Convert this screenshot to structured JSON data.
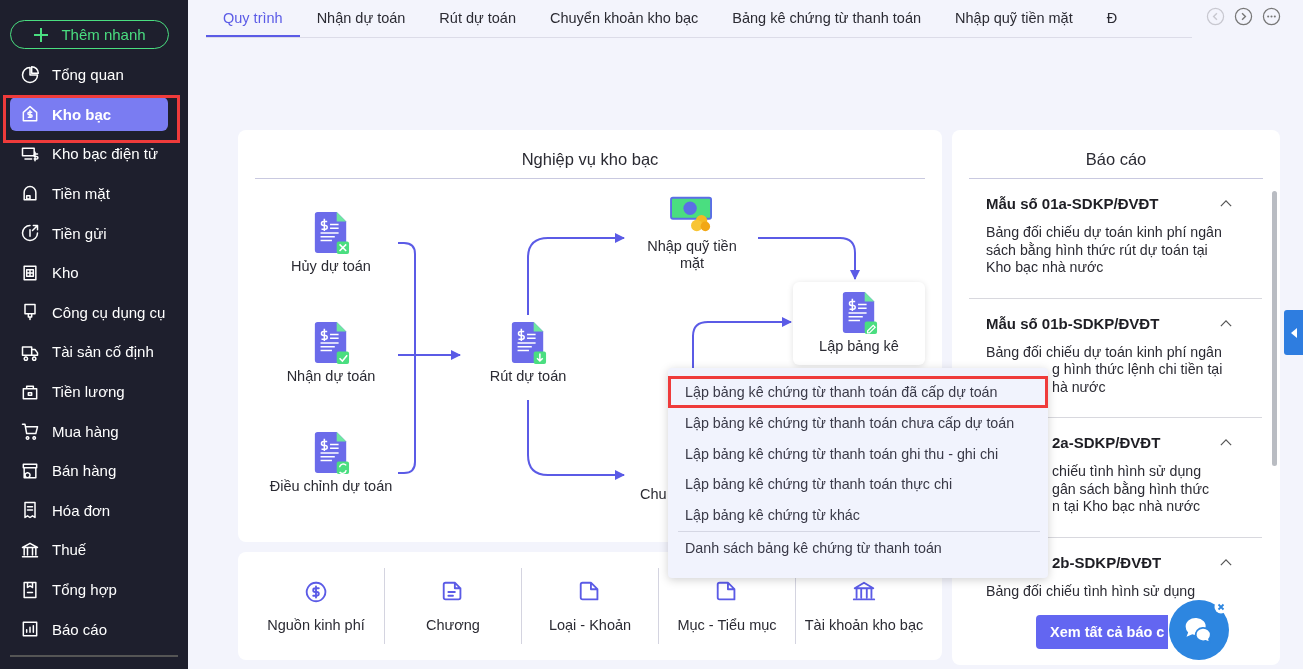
{
  "sidebar": {
    "quick_add_button": "Thêm nhanh",
    "items": [
      {
        "label": "Tổng quan",
        "selected": false,
        "highlighted": false
      },
      {
        "label": "Kho bạc",
        "selected": true,
        "highlighted": true
      },
      {
        "label": "Kho bạc điện tử",
        "selected": false,
        "highlighted": false
      },
      {
        "label": "Tiền mặt",
        "selected": false,
        "highlighted": false
      },
      {
        "label": "Tiền gửi",
        "selected": false,
        "highlighted": false
      },
      {
        "label": "Kho",
        "selected": false,
        "highlighted": false
      },
      {
        "label": "Công cụ dụng cụ",
        "selected": false,
        "highlighted": false
      },
      {
        "label": "Tài sản cố định",
        "selected": false,
        "highlighted": false
      },
      {
        "label": "Tiền lương",
        "selected": false,
        "highlighted": false
      },
      {
        "label": "Mua hàng",
        "selected": false,
        "highlighted": false
      },
      {
        "label": "Bán hàng",
        "selected": false,
        "highlighted": false
      },
      {
        "label": "Hóa đơn",
        "selected": false,
        "highlighted": false
      },
      {
        "label": "Thuế",
        "selected": false,
        "highlighted": false
      },
      {
        "label": "Tổng hợp",
        "selected": false,
        "highlighted": false
      },
      {
        "label": "Báo cáo",
        "selected": false,
        "highlighted": false
      }
    ]
  },
  "tabs": [
    {
      "label": "Quy trình",
      "selected": true
    },
    {
      "label": "Nhận dự toán",
      "selected": false
    },
    {
      "label": "Rút dự toán",
      "selected": false
    },
    {
      "label": "Chuyển khoản kho bạc",
      "selected": false
    },
    {
      "label": "Bảng kê chứng từ thanh toán",
      "selected": false
    },
    {
      "label": "Nhập quỹ tiền mặt",
      "selected": false
    },
    {
      "label": "Đ",
      "selected": false
    }
  ],
  "workflow": {
    "title": "Nghiệp vụ kho bạc",
    "nodes": [
      {
        "label": "Hủy dự toán",
        "kind": "document"
      },
      {
        "label": "Nhận dự toán",
        "kind": "document"
      },
      {
        "label": "Điều chỉnh dự toán",
        "kind": "document"
      },
      {
        "label": "Rút dự toán",
        "kind": "document"
      },
      {
        "label": "Nhập quỹ tiền mặt",
        "kind": "cash"
      },
      {
        "label": "Lập bảng kê",
        "kind": "card"
      },
      {
        "label": "Chu",
        "kind": "text"
      }
    ]
  },
  "menu": {
    "items": [
      {
        "label": "Lập bảng kê chứng từ thanh toán đã cấp dự toán",
        "highlighted": true,
        "kind": "item"
      },
      {
        "label": "Lập bảng kê chứng từ thanh toán chưa cấp dự toán",
        "highlighted": false,
        "kind": "item"
      },
      {
        "label": "Lập bảng kê chứng từ thanh toán ghi thu - ghi chi",
        "highlighted": false,
        "kind": "item"
      },
      {
        "label": "Lập bảng kê chứng từ thanh toán thực chi",
        "highlighted": false,
        "kind": "item"
      },
      {
        "label": "Lập bảng kê chứng từ khác",
        "highlighted": false,
        "kind": "item"
      },
      {
        "label": "Danh sách bảng kê chứng từ thanh toán",
        "highlighted": false,
        "kind": "footer"
      }
    ]
  },
  "catalog": {
    "items": [
      {
        "label": "Nguồn kinh phí"
      },
      {
        "label": "Chương"
      },
      {
        "label": "Loại - Khoản"
      },
      {
        "label": "Mục - Tiểu mục"
      },
      {
        "label": "Tài khoản kho bạc"
      }
    ]
  },
  "reports": {
    "title": "Báo cáo",
    "items": [
      {
        "title": {
          "text": "Mẫu số 01a-SDKP/ĐVĐT",
          "cut": false
        },
        "lines": [
          {
            "text": "Bảng đối chiếu dự toán kinh phí ngân",
            "cut": false
          },
          {
            "text": "sách bằng hình thức rút dự toán tại",
            "cut": false
          },
          {
            "text": "Kho bạc nhà nước",
            "cut": false
          }
        ]
      },
      {
        "title": {
          "text": "Mẫu số 01b-SDKP/ĐVĐT",
          "cut": false
        },
        "lines": [
          {
            "text": "Bảng đối chiếu dự toán kinh phí ngân",
            "cut": false
          },
          {
            "text": "g hình thức lệnh chi tiền tại",
            "cut": true
          },
          {
            "text": "hà nước",
            "cut": true
          }
        ]
      },
      {
        "title": {
          "text": "2a-SDKP/ĐVĐT",
          "cut": true
        },
        "lines": [
          {
            "text": "chiếu tình hình sử dụng",
            "cut": true
          },
          {
            "text": "gân sách bằng hình thức",
            "cut": true
          },
          {
            "text": "n tại Kho bạc nhà nước",
            "cut": true
          }
        ]
      },
      {
        "title": {
          "text": "2b-SDKP/ĐVĐT",
          "cut": true
        },
        "lines": [
          {
            "text": "Bảng đối chiếu tình hình sử dụng",
            "cut": false
          }
        ]
      }
    ],
    "button": "Xem tất cả báo c"
  }
}
